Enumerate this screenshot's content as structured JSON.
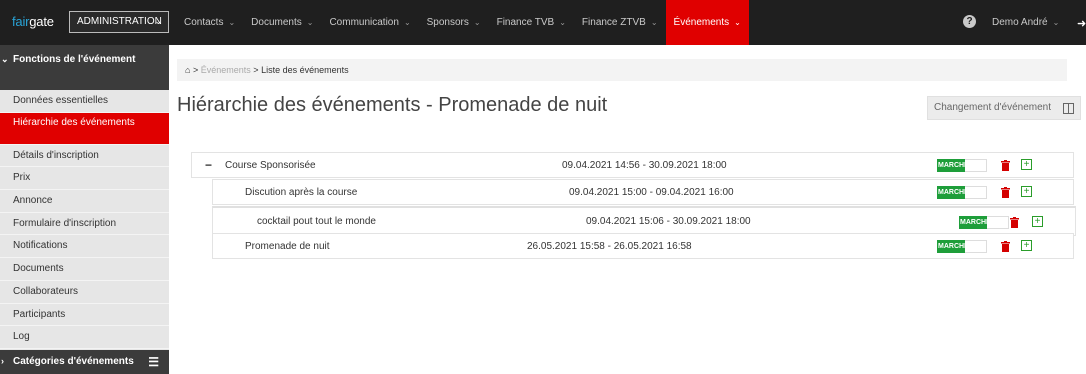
{
  "header": {
    "logo_fair": "fair",
    "logo_gate": "gate",
    "admin_label": "ADMINISTRATION",
    "nav": [
      {
        "label": "Contacts"
      },
      {
        "label": "Documents"
      },
      {
        "label": "Communication"
      },
      {
        "label": "Sponsors"
      },
      {
        "label": "Finance TVB"
      },
      {
        "label": "Finance ZTVB"
      },
      {
        "label": "Événements"
      }
    ],
    "active_nav": "Événements",
    "help_glyph": "?",
    "user_label": "Demo André"
  },
  "sidebar": {
    "section_title": "Fonctions de l'événement",
    "items": [
      {
        "label": "Données essentielles"
      },
      {
        "label": "Hiérarchie des événements"
      },
      {
        "label": "Détails d'inscription"
      },
      {
        "label": "Prix"
      },
      {
        "label": "Annonce"
      },
      {
        "label": "Formulaire d'inscription"
      },
      {
        "label": "Notifications"
      },
      {
        "label": "Documents"
      },
      {
        "label": "Collaborateurs"
      },
      {
        "label": "Participants"
      },
      {
        "label": "Log"
      }
    ],
    "active_item": "Hiérarchie des événements",
    "footer_title": "Catégories d'événements"
  },
  "breadcrumb": {
    "sep": ">",
    "level1": "Événements",
    "current": "Liste des événements"
  },
  "page_title": "Hiérarchie des événements - Promenade de nuit",
  "change_button": "Changement d'événement",
  "events": [
    {
      "name": "Course Sponsorisée",
      "dates": "09.04.2021 14:56 - 30.09.2021 18:00",
      "status": "MARCHÉ"
    },
    {
      "name": "Discution après la course",
      "dates": "09.04.2021 15:00 - 09.04.2021 16:00",
      "status": "MARCHÉ"
    },
    {
      "name": "cocktail pout tout le monde",
      "dates": "09.04.2021 15:06 - 30.09.2021 18:00",
      "status": "MARCHÉ"
    },
    {
      "name": "Promenade de nuit",
      "dates": "26.05.2021 15:58 - 26.05.2021 16:58",
      "status": "MARCHÉ"
    }
  ],
  "colors": {
    "accent_red": "#e00000",
    "status_green": "#1e9e3a",
    "topbar": "#1f1f1f"
  },
  "icons": [
    "home-icon",
    "chevron-down-icon",
    "help-icon",
    "logout-icon",
    "minus-icon",
    "trash-icon",
    "plus-icon",
    "columns-icon",
    "menu-icon"
  ]
}
